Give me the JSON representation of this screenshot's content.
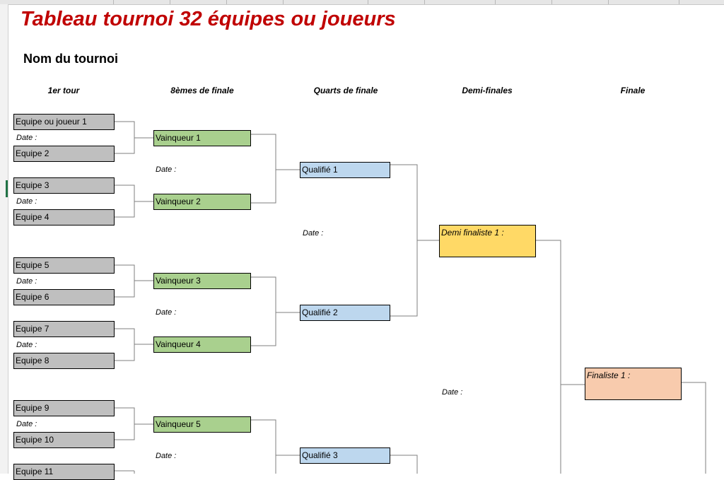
{
  "title": "Tableau tournoi 32 équipes ou joueurs",
  "subtitle": "Nom du tournoi",
  "columns": [
    "1er tour",
    "8èmes de finale",
    "Quarts de finale",
    "Demi-finales",
    "Finale"
  ],
  "date_label": "Date :",
  "round1": {
    "teams": [
      "Equipe ou joueur 1",
      "Equipe 2",
      "Equipe 3",
      "Equipe 4",
      "Equipe 5",
      "Equipe 6",
      "Equipe 7",
      "Equipe 8",
      "Equipe 9",
      "Equipe 10",
      "Equipe 11"
    ]
  },
  "round2": {
    "winners": [
      "Vainqueur 1",
      "Vainqueur 2",
      "Vainqueur 3",
      "Vainqueur 4",
      "Vainqueur 5"
    ]
  },
  "round3": {
    "qualified": [
      "Qualifié 1",
      "Qualifié 2",
      "Qualifié 3"
    ]
  },
  "round4": {
    "semi": [
      "Demi finaliste 1 :"
    ]
  },
  "round5": {
    "final": [
      "Finaliste 1 :"
    ]
  },
  "colors": {
    "title": "#c00000",
    "round1": "#bfbfbf",
    "round2": "#a9d08e",
    "round3": "#bdd7ee",
    "semi": "#ffd966",
    "final": "#f8cbad",
    "connector": "#7f7f7f"
  }
}
